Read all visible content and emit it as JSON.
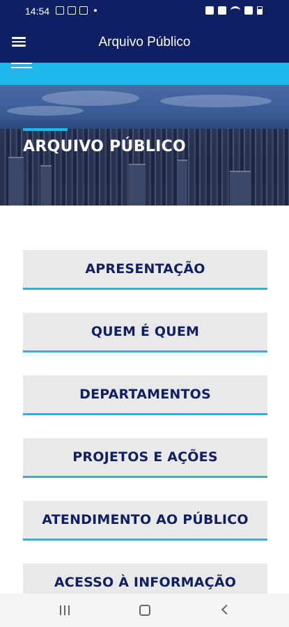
{
  "status_bar": {
    "time": "14:54"
  },
  "app_bar": {
    "title": "Arquivo Público"
  },
  "hero": {
    "title": "ARQUIVO PÚBLICO"
  },
  "menu": {
    "items": [
      {
        "label": "APRESENTAÇÃO"
      },
      {
        "label": "QUEM É QUEM"
      },
      {
        "label": "DEPARTAMENTOS"
      },
      {
        "label": "PROJETOS E AÇÕES"
      },
      {
        "label": "ATENDIMENTO AO PÚBLICO"
      },
      {
        "label": "ACESSO À INFORMAÇÃO"
      }
    ]
  },
  "colors": {
    "primary": "#0e1f63",
    "accent": "#1fb7ea",
    "card": "#e9e9e9"
  },
  "icons": [
    "menu-icon",
    "wifi-icon",
    "battery-icon",
    "signal-icon",
    "alarm-icon",
    "mute-icon"
  ]
}
